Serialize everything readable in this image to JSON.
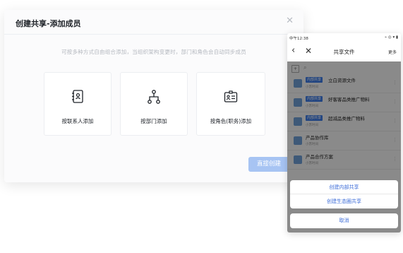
{
  "dialog": {
    "title": "创建共享-添加成员",
    "close_icon": "close-icon",
    "hint": "可按多种方式自由组合添加，当组织架构变更时，部门和角色会自动同步成员",
    "options": [
      {
        "label": "按联系人添加",
        "icon": "contact-book-icon"
      },
      {
        "label": "按部门添加",
        "icon": "org-tree-icon"
      },
      {
        "label": "按角色(职务)添加",
        "icon": "id-card-icon"
      }
    ],
    "direct_create": "直接创建",
    "accent": "#a7c4f3"
  },
  "phone": {
    "status_time": "中午12:38",
    "status_icons": "⌁ ◎ ▾ ▮",
    "back_icon": "‹",
    "close_icon": "✕",
    "title": "共享文件",
    "more": "更多",
    "search_icon": "search-icon",
    "files": [
      {
        "tag": "内部共享",
        "name": "立白资源文件",
        "sub": "小苏时间"
      },
      {
        "tag": "内部共享",
        "name": "好客客品类推广物料",
        "sub": "小苏时间"
      },
      {
        "tag": "内部共享",
        "name": "超减品类推广物料",
        "sub": "小苏时间"
      },
      {
        "tag": "",
        "name": "产品协作库",
        "sub": "小苏时间"
      },
      {
        "tag": "",
        "name": "产品合作方案",
        "sub": "小苏时间"
      }
    ],
    "sheet": {
      "internal_share": "创建内部共享",
      "ecosystem_share": "创建生态圈共享",
      "cancel": "取消"
    },
    "link_color": "#3d6dd8"
  }
}
